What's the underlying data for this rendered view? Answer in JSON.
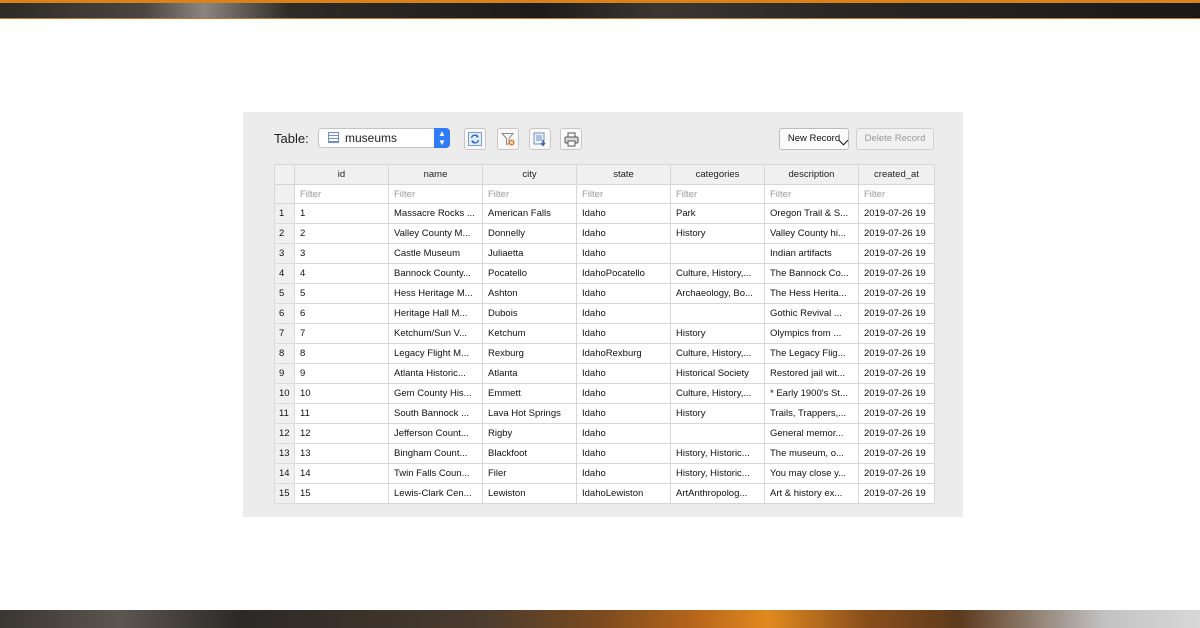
{
  "toolbar": {
    "table_label": "Table:",
    "selected_table": "museums",
    "new_record_label": "New Record",
    "delete_record_label": "Delete Record"
  },
  "columns": [
    "id",
    "name",
    "city",
    "state",
    "categories",
    "description",
    "created_at"
  ],
  "filter_placeholder": "Filter",
  "rows": [
    [
      "1",
      "1",
      "Massacre Rocks ...",
      "American Falls",
      "Idaho",
      "Park",
      "Oregon Trail & S...",
      "2019-07-26 19"
    ],
    [
      "2",
      "2",
      "Valley County M...",
      "Donnelly",
      "Idaho",
      "History",
      "Valley County hi...",
      "2019-07-26 19"
    ],
    [
      "3",
      "3",
      "Castle Museum",
      "Juliaetta",
      "Idaho",
      "",
      "Indian artifacts",
      "2019-07-26 19"
    ],
    [
      "4",
      "4",
      "Bannock County...",
      "Pocatello",
      "IdahoPocatello",
      "Culture, History,...",
      "The Bannock Co...",
      "2019-07-26 19"
    ],
    [
      "5",
      "5",
      "Hess Heritage M...",
      "Ashton",
      "Idaho",
      "Archaeology, Bo...",
      "The Hess Herita...",
      "2019-07-26 19"
    ],
    [
      "6",
      "6",
      "Heritage Hall M...",
      "Dubois",
      "Idaho",
      "",
      "Gothic Revival ...",
      "2019-07-26 19"
    ],
    [
      "7",
      "7",
      "Ketchum/Sun V...",
      "Ketchum",
      "Idaho",
      "History",
      "Olympics from ...",
      "2019-07-26 19"
    ],
    [
      "8",
      "8",
      "Legacy Flight M...",
      "Rexburg",
      "IdahoRexburg",
      "Culture, History,...",
      "The Legacy Flig...",
      "2019-07-26 19"
    ],
    [
      "9",
      "9",
      "Atlanta Historic...",
      "Atlanta",
      "Idaho",
      "Historical Society",
      "Restored jail wit...",
      "2019-07-26 19"
    ],
    [
      "10",
      "10",
      "Gem County His...",
      "Emmett",
      "Idaho",
      "Culture, History,...",
      "* Early 1900's St...",
      "2019-07-26 19"
    ],
    [
      "11",
      "11",
      "South Bannock ...",
      "Lava Hot Springs",
      "Idaho",
      "History",
      "Trails, Trappers,...",
      "2019-07-26 19"
    ],
    [
      "12",
      "12",
      "Jefferson Count...",
      "Rigby",
      "Idaho",
      "",
      "General memor...",
      "2019-07-26 19"
    ],
    [
      "13",
      "13",
      "Bingham Count...",
      "Blackfoot",
      "Idaho",
      "History, Historic...",
      "The museum, o...",
      "2019-07-26 19"
    ],
    [
      "14",
      "14",
      "Twin Falls Coun...",
      "Filer",
      "Idaho",
      "History, Historic...",
      "You may close y...",
      "2019-07-26 19"
    ],
    [
      "15",
      "15",
      "Lewis-Clark Cen...",
      "Lewiston",
      "IdahoLewiston",
      "ArtAnthropolog...",
      "Art & history ex...",
      "2019-07-26 19"
    ]
  ],
  "icons": {
    "table_select": "table-icon",
    "refresh": "refresh-icon",
    "filter": "filter-clear-icon",
    "export": "export-icon",
    "print": "print-icon"
  },
  "colors": {
    "accent": "#2f7cf6",
    "banner_orange": "#d9821c"
  }
}
